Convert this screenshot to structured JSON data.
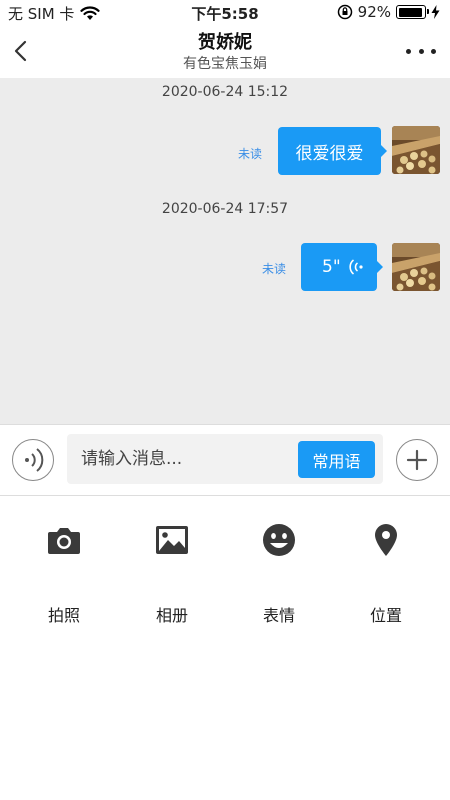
{
  "status_bar": {
    "carrier": "无 SIM 卡",
    "time": "下午5:58",
    "battery_text": "92%",
    "battery_level": 0.92
  },
  "header": {
    "title": "贺娇妮",
    "subtitle": "有色宝焦玉娟"
  },
  "messages": [
    {
      "timestamp": "2020-06-24 15:12",
      "type": "text",
      "text": "很爱很爱",
      "status": "未读"
    },
    {
      "timestamp": "2020-06-24 17:57",
      "type": "voice",
      "text": "5\"",
      "status": "未读"
    }
  ],
  "input": {
    "placeholder": "请输入消息...",
    "phrase_button": "常用语"
  },
  "tools": [
    {
      "label": "拍照",
      "icon": "camera-icon"
    },
    {
      "label": "相册",
      "icon": "image-icon"
    },
    {
      "label": "表情",
      "icon": "smiley-icon"
    },
    {
      "label": "位置",
      "icon": "location-pin-icon"
    }
  ],
  "colors": {
    "accent": "#1a9af5",
    "chat_bg": "#ececec",
    "unread": "#3a8ee6"
  }
}
